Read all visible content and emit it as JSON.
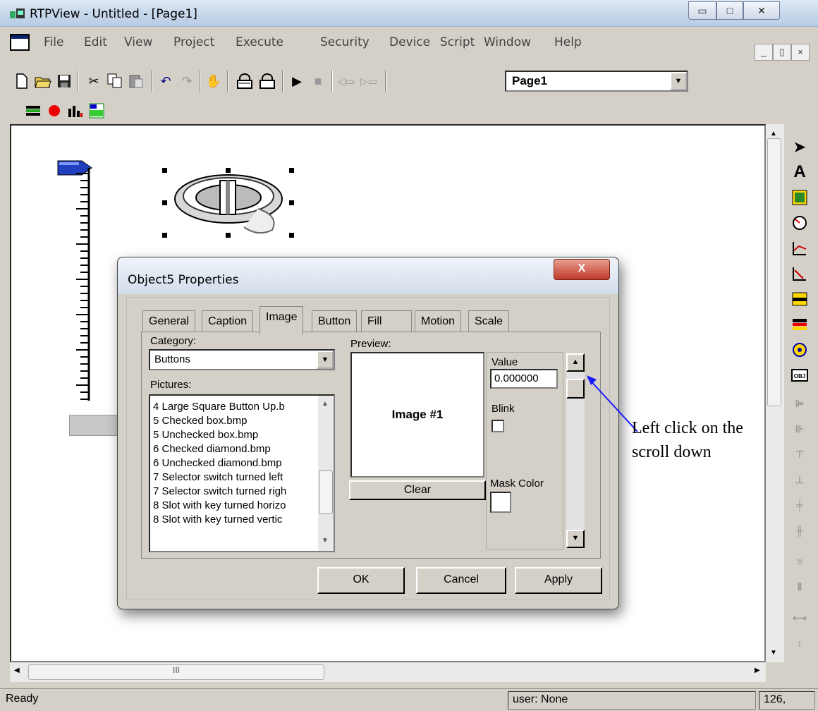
{
  "window": {
    "title": "RTPView - Untitled - [Page1]",
    "min_glyph": "▭",
    "max_glyph": "□",
    "close_glyph": "✕"
  },
  "menu": {
    "items": [
      "File",
      "Edit",
      "View",
      "Project",
      "Execute",
      "Security",
      "Device",
      "Script",
      "Window",
      "Help"
    ],
    "mdi_min": "_",
    "mdi_restore": "▯",
    "mdi_close": "×"
  },
  "toolbar": {
    "page_select": "Page1"
  },
  "dialog": {
    "title": "Object5 Properties",
    "close_glyph": "X",
    "tabs": [
      "General",
      "Caption",
      "Image",
      "Button",
      "Fill",
      "Motion",
      "Scale"
    ],
    "active_tab": "Image",
    "category_label": "Category:",
    "category_value": "Buttons",
    "pictures_label": "Pictures:",
    "pictures": [
      "4 Large Square Button Up.b",
      "5 Checked box.bmp",
      "5 Unchecked box.bmp",
      "6 Checked diamond.bmp",
      "6 Unchecked diamond.bmp",
      "7 Selector switch turned left",
      "7 Selector switch turned righ",
      "8 Slot with key turned horizo",
      "8 Slot with key turned vertic"
    ],
    "preview_label": "Preview:",
    "preview_text": "Image #1",
    "clear_label": "Clear",
    "value_label": "Value",
    "value": "0.000000",
    "blink_label": "Blink",
    "mask_color_label": "Mask Color",
    "ok_label": "OK",
    "cancel_label": "Cancel",
    "apply_label": "Apply"
  },
  "canvas": {
    "hscroll_grip": "III"
  },
  "annotation": {
    "line1": "Left click on the",
    "line2": "scroll down"
  },
  "status": {
    "ready": "Ready",
    "user": "user: None",
    "coords": "126,"
  },
  "colors": {
    "annotation_arrow": "#1a1aff",
    "selection_handle": "#000000",
    "pointer_blue": "#1f3fbf"
  }
}
